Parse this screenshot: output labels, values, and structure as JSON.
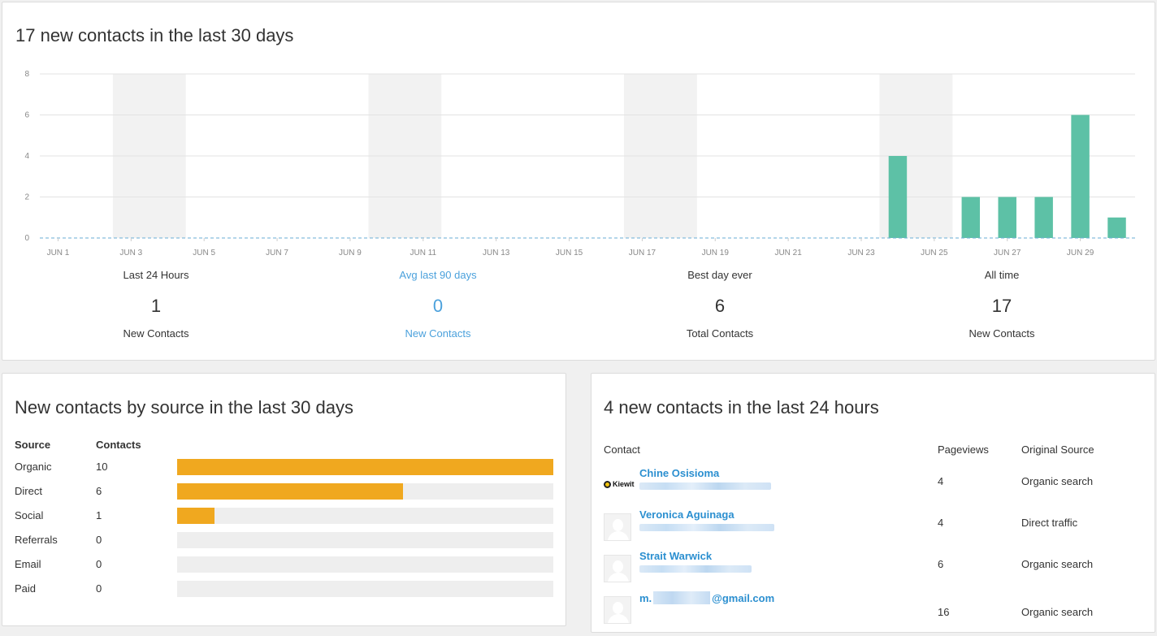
{
  "top": {
    "title": "17 new contacts in the last 30 days",
    "stats": [
      {
        "label": "Last 24 Hours",
        "value": "1",
        "sub": "New Contacts",
        "link": false
      },
      {
        "label": "Avg last 90 days",
        "value": "0",
        "sub": "New Contacts",
        "link": true
      },
      {
        "label": "Best day ever",
        "value": "6",
        "sub": "Total Contacts",
        "link": false
      },
      {
        "label": "All time",
        "value": "17",
        "sub": "New Contacts",
        "link": false
      }
    ]
  },
  "chart_data": {
    "type": "bar",
    "title": "17 new contacts in the last 30 days",
    "categories": [
      "JUN 1",
      "JUN 2",
      "JUN 3",
      "JUN 4",
      "JUN 5",
      "JUN 6",
      "JUN 7",
      "JUN 8",
      "JUN 9",
      "JUN 10",
      "JUN 11",
      "JUN 12",
      "JUN 13",
      "JUN 14",
      "JUN 15",
      "JUN 16",
      "JUN 17",
      "JUN 18",
      "JUN 19",
      "JUN 20",
      "JUN 21",
      "JUN 22",
      "JUN 23",
      "JUN 24",
      "JUN 25",
      "JUN 26",
      "JUN 27",
      "JUN 28",
      "JUN 29",
      "JUN 30"
    ],
    "tick_labels": [
      "JUN 1",
      "JUN 3",
      "JUN 5",
      "JUN 7",
      "JUN 9",
      "JUN 11",
      "JUN 13",
      "JUN 15",
      "JUN 17",
      "JUN 19",
      "JUN 21",
      "JUN 23",
      "JUN 25",
      "JUN 27",
      "JUN 29"
    ],
    "values": [
      0,
      0,
      0,
      0,
      0,
      0,
      0,
      0,
      0,
      0,
      0,
      0,
      0,
      0,
      0,
      0,
      0,
      0,
      0,
      0,
      0,
      0,
      0,
      4,
      0,
      2,
      2,
      2,
      6,
      1
    ],
    "weekend_bands": [
      [
        "JUN 3",
        "JUN 4"
      ],
      [
        "JUN 10",
        "JUN 11"
      ],
      [
        "JUN 17",
        "JUN 18"
      ],
      [
        "JUN 24",
        "JUN 25"
      ]
    ],
    "yticks": [
      0,
      2,
      4,
      6,
      8
    ],
    "ylim": [
      0,
      8
    ],
    "grid": true,
    "baseline_dashed": true,
    "colors": {
      "bar": "#5dc1a6",
      "band": "#f2f2f2",
      "grid": "#e3e3e3",
      "baseline": "#6aaed6"
    }
  },
  "source": {
    "title": "New contacts by source in the last 30 days",
    "headers": {
      "source": "Source",
      "contacts": "Contacts"
    },
    "max": 10,
    "rows": [
      {
        "name": "Organic",
        "count": 10
      },
      {
        "name": "Direct",
        "count": 6
      },
      {
        "name": "Social",
        "count": 1
      },
      {
        "name": "Referrals",
        "count": 0
      },
      {
        "name": "Email",
        "count": 0
      },
      {
        "name": "Paid",
        "count": 0
      }
    ],
    "colors": {
      "bar": "#f0a81f",
      "track": "#eeeeee"
    }
  },
  "recent": {
    "title": "4 new contacts in the last 24 hours",
    "headers": {
      "contact": "Contact",
      "pageviews": "Pageviews",
      "source": "Original Source"
    },
    "rows": [
      {
        "name": "Chine Osisioma",
        "pageviews": "4",
        "source": "Organic search",
        "avatar": "kiewit-logo",
        "logo_text": "Kiewit"
      },
      {
        "name": "Veronica Aguinaga",
        "pageviews": "4",
        "source": "Direct traffic",
        "avatar": "default-avatar"
      },
      {
        "name": "Strait Warwick",
        "pageviews": "6",
        "source": "Organic search",
        "avatar": "default-avatar"
      },
      {
        "name_prefix": "m.",
        "name_suffix": "@gmail.com",
        "pageviews": "16",
        "source": "Organic search",
        "avatar": "default-avatar"
      }
    ]
  }
}
